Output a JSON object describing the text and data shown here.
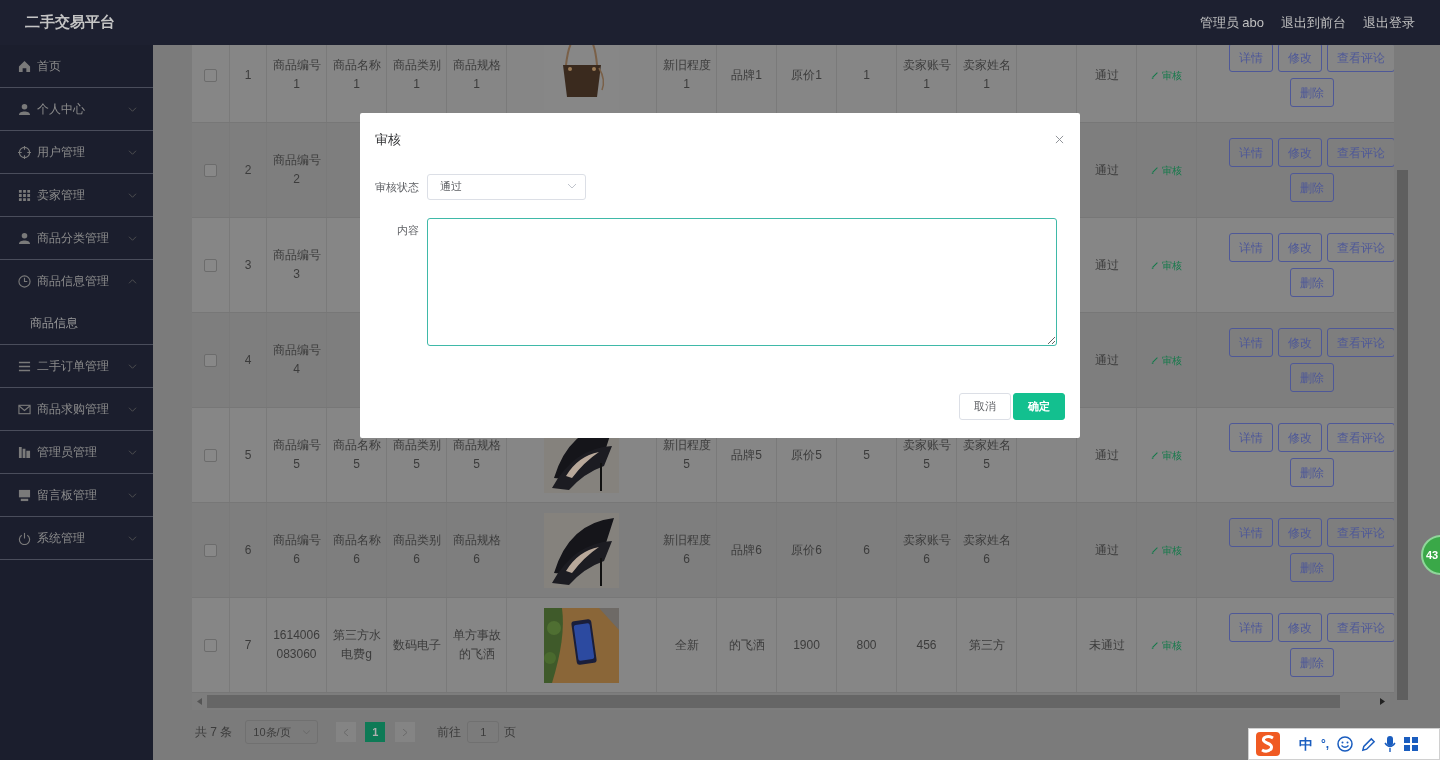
{
  "header": {
    "title": "二手交易平台",
    "user": "管理员 abo",
    "links": [
      "退出到前台",
      "退出登录"
    ]
  },
  "sidebar": {
    "items": [
      {
        "label": "首页",
        "kind": "link"
      },
      {
        "label": "个人中心",
        "kind": "menu",
        "expanded": false
      },
      {
        "label": "用户管理",
        "kind": "menu",
        "expanded": false
      },
      {
        "label": "卖家管理",
        "kind": "menu",
        "expanded": false
      },
      {
        "label": "商品分类管理",
        "kind": "menu",
        "expanded": false
      },
      {
        "label": "商品信息管理",
        "kind": "menu",
        "expanded": true,
        "children": [
          {
            "label": "商品信息"
          }
        ]
      },
      {
        "label": "二手订单管理",
        "kind": "menu",
        "expanded": false
      },
      {
        "label": "商品求购管理",
        "kind": "menu",
        "expanded": false
      },
      {
        "label": "管理员管理",
        "kind": "menu",
        "expanded": false
      },
      {
        "label": "留言板管理",
        "kind": "menu",
        "expanded": false
      },
      {
        "label": "系统管理",
        "kind": "menu",
        "expanded": false
      }
    ]
  },
  "table": {
    "rows": [
      {
        "checked": false,
        "picture": true,
        "cells": [
          "1",
          "商品编号1",
          "商品名称1",
          "商品类别1",
          "商品规格1",
          "新旧程度1",
          "品牌1",
          "原价1",
          "1",
          "卖家账号1",
          "卖家姓名1"
        ],
        "status": "通过",
        "review": "审核",
        "buttons": [
          "详情",
          "修改",
          "查看评论",
          "删除"
        ]
      },
      {
        "checked": false,
        "cells": [
          "2",
          "商品编号2",
          null,
          null,
          null,
          null,
          null,
          null,
          null,
          null,
          null
        ],
        "status": "通过",
        "review": "审核",
        "buttons": [
          "详情",
          "修改",
          "查看评论",
          "删除"
        ]
      },
      {
        "checked": false,
        "cells": [
          "3",
          "商品编号3",
          null,
          null,
          null,
          null,
          null,
          null,
          null,
          null,
          null
        ],
        "status": "通过",
        "review": "审核",
        "buttons": [
          "详情",
          "修改",
          "查看评论",
          "删除"
        ]
      },
      {
        "checked": false,
        "cells": [
          "4",
          "商品编号4",
          null,
          null,
          null,
          null,
          null,
          null,
          null,
          null,
          null
        ],
        "status": "通过",
        "review": "审核",
        "buttons": [
          "详情",
          "修改",
          "查看评论",
          "删除"
        ]
      },
      {
        "checked": false,
        "picture": true,
        "cells": [
          "5",
          "商品编号5",
          "商品名称5",
          "商品类别5",
          "商品规格5",
          "新旧程度5",
          "品牌5",
          "原价5",
          "5",
          "卖家账号5",
          "卖家姓名5"
        ],
        "status": "通过",
        "review": "审核",
        "buttons": [
          "详情",
          "修改",
          "查看评论",
          "删除"
        ]
      },
      {
        "checked": false,
        "picture": true,
        "cells": [
          "6",
          "商品编号6",
          "商品名称6",
          "商品类别6",
          "商品规格6",
          "新旧程度6",
          "品牌6",
          "原价6",
          "6",
          "卖家账号6",
          "卖家姓名6"
        ],
        "status": "通过",
        "review": "审核",
        "buttons": [
          "详情",
          "修改",
          "查看评论",
          "删除"
        ]
      },
      {
        "checked": false,
        "picture": true,
        "cells": [
          "7",
          "1614006083060",
          "第三方水电费g",
          "数码电子",
          "单方事故的飞洒",
          "全新",
          "的飞洒",
          "1900",
          "800",
          "456",
          "第三方"
        ],
        "status": "未通过",
        "review": "审核",
        "buttons": [
          "详情",
          "修改",
          "查看评论",
          "删除"
        ]
      }
    ]
  },
  "pagination": {
    "total": "共 7 条",
    "page_size": "10条/页",
    "pages": [
      {
        "label": "1",
        "selected": true
      }
    ],
    "goto_label": "前往",
    "goto_value": "1",
    "goto_suffix": "页"
  },
  "dialog": {
    "title": "审核",
    "fields": [
      {
        "label": "审核状态",
        "kind": "select",
        "value": "通过"
      },
      {
        "label": "内容",
        "kind": "textarea",
        "focused": true
      }
    ],
    "buttons": [
      {
        "label": "取消",
        "kind": "secondary"
      },
      {
        "label": "确定",
        "kind": "primary"
      }
    ]
  },
  "ime": {
    "mode": "中",
    "punctuation": "°,"
  },
  "badge": "43"
}
